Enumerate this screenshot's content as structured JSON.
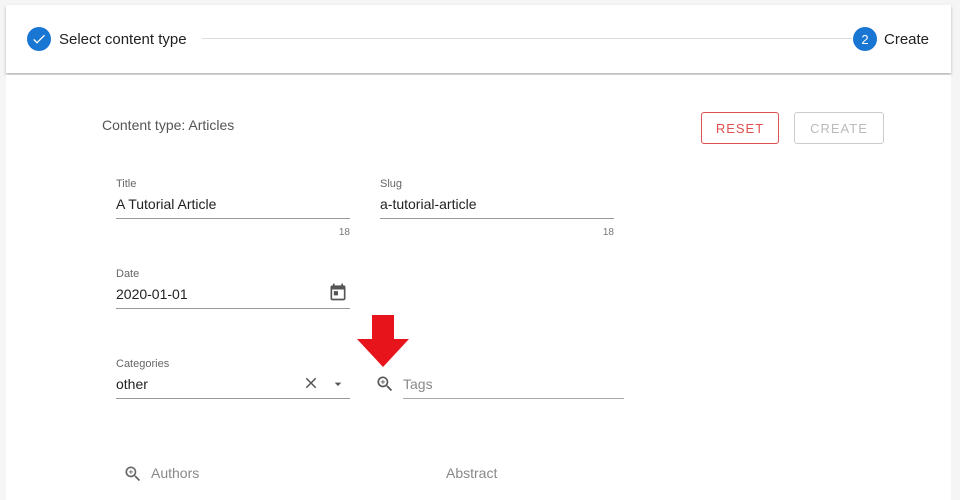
{
  "stepper": {
    "step1": {
      "label": "Select content type",
      "state": "complete"
    },
    "step2": {
      "number": "2",
      "label": "Create",
      "state": "active"
    },
    "accent_color": "#1976d2"
  },
  "form": {
    "content_type_label": "Content type: Articles",
    "reset_label": "RESET",
    "create_label": "CREATE",
    "title": {
      "label": "Title",
      "value": "A Tutorial Article",
      "counter": "18"
    },
    "slug": {
      "label": "Slug",
      "value": "a-tutorial-article",
      "counter": "18"
    },
    "date": {
      "label": "Date",
      "value": "2020-01-01",
      "icon": "calendar-icon"
    },
    "categories": {
      "label": "Categories",
      "value": "other"
    },
    "tags": {
      "placeholder": "Tags",
      "icon": "zoom-in-icon"
    },
    "authors": {
      "placeholder": "Authors",
      "icon": "zoom-in-icon"
    },
    "abstract": {
      "placeholder": "Abstract"
    }
  },
  "annotation": {
    "icon": "red-arrow-down-icon",
    "color": "#e8141b"
  }
}
